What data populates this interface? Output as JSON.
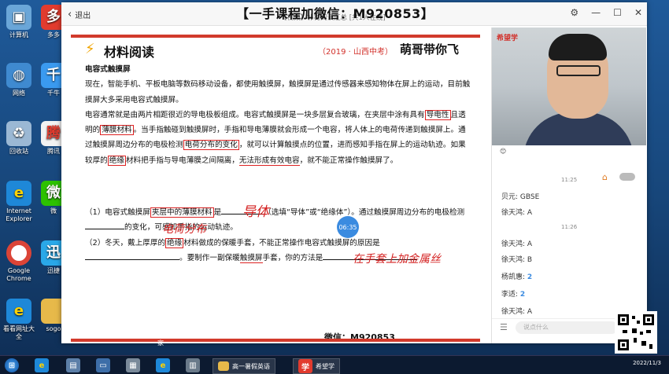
{
  "desktop": {
    "icons_left": [
      {
        "label": "计算机",
        "icon": "computer-icon"
      },
      {
        "label": "网络",
        "icon": "network-icon"
      },
      {
        "label": "回收站",
        "icon": "recycle-bin-icon"
      },
      {
        "label": "Internet Explorer",
        "icon": "ie-icon"
      },
      {
        "label": "Google Chrome",
        "icon": "chrome-icon"
      },
      {
        "label": "看看网址大全",
        "icon": "ie-icon"
      }
    ],
    "icons_second": [
      {
        "label": "多多",
        "icon": "app-icon"
      },
      {
        "label": "千牛",
        "icon": "app-icon"
      },
      {
        "label": "腾讯",
        "icon": "app-icon"
      },
      {
        "label": "微",
        "icon": "wechat-icon"
      },
      {
        "label": "迅捷",
        "icon": "app-icon"
      },
      {
        "label": "sogo",
        "icon": "folder-icon"
      }
    ]
  },
  "window": {
    "back_label": "退出",
    "banner": "【一手课程加微信：M920853】",
    "subtitle": "【视频】补材阅读汇总 [共1人在线]"
  },
  "slide": {
    "title": "材料阅读",
    "exam": "（2019 · 山西中考）",
    "brand": "萌哥带你飞",
    "heading": "电容式触摸屏",
    "p1": "现在，智能手机、平板电脑等数码移动设备，都使用触摸屏，触摸屏是通过传感器来感知物体在屏上的运动，目前触摸屏大多采用电容式触摸屏。",
    "p2_a": "电容通常就是由两片相距很近的导电极板组成。电容式触摸屏是一块多层复合玻璃，在夹层中涂有具有",
    "p2_box1": "导电性",
    "p2_b": "且透明的",
    "p2_box2": "薄膜材料",
    "p2_c": "。当手指触碰到触摸屏时，手指和导电薄膜就会形成一个电容，将人体上的电荷传递到触摸屏上。通过触摸屏周边分布的电极检测",
    "p2_box3": "电荷分布的变化",
    "p2_d": "，就可以计算触摸点的位置，进而感知手指在屏上的运动轨迹。如果较厚的",
    "p2_box4": "绝缘",
    "p2_e": "材料把手指与导电薄膜之间隔离，",
    "p2_ul": "无法形成有效电容",
    "p2_f": "，就不能正常操作触摸屏了。",
    "q1_a": "（1）电容式触摸屏",
    "q1_box": "夹层中的薄膜材料",
    "q1_b": "是",
    "q1_c": "（选填“导体”或“绝缘体”）。通过触摸屏周边分布的电极检测",
    "q1_d": "的变化，可感知手指的运动轨迹。",
    "q2_a": "（2）冬天，戴上厚厚的",
    "q2_box": "绝缘",
    "q2_b": "材料做成的保暖手套，不能正常操作电容式触摸屏的原因是",
    "q2_c": "。要制作一副保暖",
    "q2_ul": "触摸屏",
    "q2_d": "手套，你的方法是",
    "hand1": "导体",
    "hand2": "电荷分布",
    "hand3": "在手套上加金属丝",
    "weixin": "微信：M920853",
    "timer": "06:35"
  },
  "panel": {
    "school": "希望学",
    "messages": [
      {
        "name": "贝元",
        "text": "GBSE"
      },
      {
        "name": "徐天鸿",
        "text": "A"
      },
      {
        "name": "徐天鸿",
        "text": "A"
      },
      {
        "name": "徐天鸿",
        "text": "B"
      },
      {
        "name": "杨凯惠",
        "text": "2"
      },
      {
        "name": "李适",
        "text": "2"
      },
      {
        "name": "徐天鸿",
        "text": "A"
      }
    ],
    "times": [
      "11:25",
      "11:26"
    ],
    "input_placeholder": "说点什么"
  },
  "taskbar": {
    "items": [
      {
        "label": "家",
        "icon": "folder-icon"
      },
      {
        "label": "高一暑假英语",
        "icon": "folder-icon"
      },
      {
        "label": "希望学",
        "icon": "app-icon"
      }
    ],
    "date": "2022/11/3"
  }
}
